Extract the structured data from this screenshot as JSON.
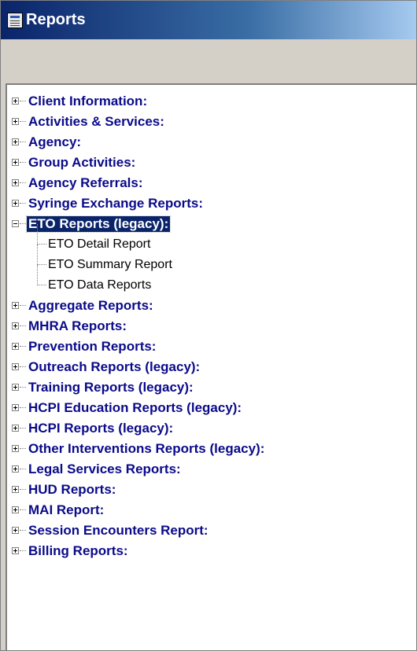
{
  "window": {
    "title": "Reports"
  },
  "tree": {
    "categories_before": [
      {
        "label": "Client Information:"
      },
      {
        "label": "Activities & Services:"
      },
      {
        "label": "Agency:"
      },
      {
        "label": "Group Activities:"
      },
      {
        "label": "Agency Referrals:"
      },
      {
        "label": "Syringe Exchange Reports:"
      }
    ],
    "expanded": {
      "label": "ETO Reports (legacy):",
      "selected": true,
      "children": [
        {
          "label": "ETO Detail Report"
        },
        {
          "label": "ETO Summary Report"
        },
        {
          "label": "ETO Data Reports"
        }
      ]
    },
    "categories_after": [
      {
        "label": "Aggregate Reports:"
      },
      {
        "label": "MHRA Reports:"
      },
      {
        "label": "Prevention Reports:"
      },
      {
        "label": "Outreach Reports (legacy):"
      },
      {
        "label": "Training Reports (legacy):"
      },
      {
        "label": "HCPI Education Reports (legacy):"
      },
      {
        "label": "HCPI Reports (legacy):"
      },
      {
        "label": "Other Interventions Reports (legacy):"
      },
      {
        "label": "Legal Services Reports:"
      },
      {
        "label": "HUD Reports:"
      },
      {
        "label": "MAI Report:"
      },
      {
        "label": "Session Encounters Report:"
      },
      {
        "label": "Billing Reports:"
      }
    ]
  },
  "colors": {
    "titlebar_start": "#0a246a",
    "category_text": "#0a0a8a",
    "selection": "#0a246a"
  },
  "icons": {
    "app": "reports-window-icon",
    "collapsed": "plus-expander-icon",
    "expanded": "minus-expander-icon"
  }
}
